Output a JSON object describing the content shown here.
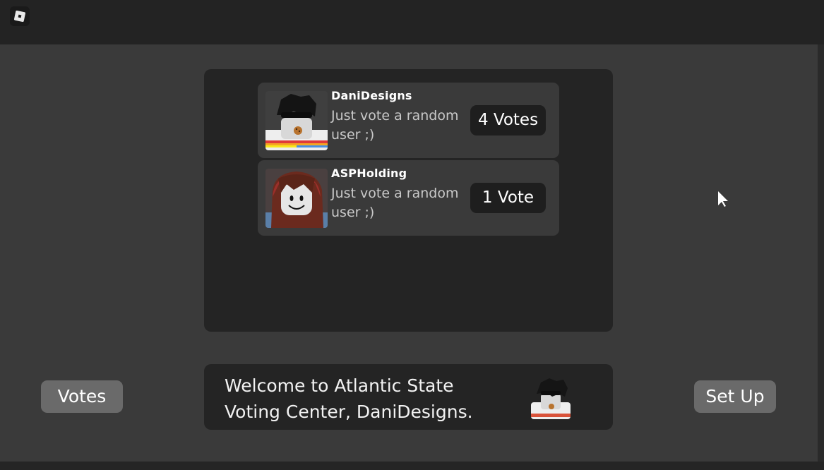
{
  "topbar": {
    "menu_icon": "roblox-logo-icon"
  },
  "vote_panel": {
    "candidates": [
      {
        "name": "DaniDesigns",
        "message": "Just vote a random user ;)",
        "votes_label": "4 Votes",
        "avatar_icon": "avatar-icon"
      },
      {
        "name": "ASPHolding",
        "message": "Just vote a random user ;)",
        "votes_label": "1 Vote",
        "avatar_icon": "avatar-icon"
      }
    ]
  },
  "welcome": {
    "message": "Welcome to Atlantic State Voting Center, DaniDesigns.",
    "avatar_icon": "avatar-icon"
  },
  "buttons": {
    "votes_label": "Votes",
    "setup_label": "Set Up"
  },
  "colors": {
    "background": "#3a3a3a",
    "panel": "#242424",
    "card": "#3a3a3a",
    "badge": "#1e1e1e",
    "side_button": "#6a6a6a",
    "text": "#ffffff"
  }
}
